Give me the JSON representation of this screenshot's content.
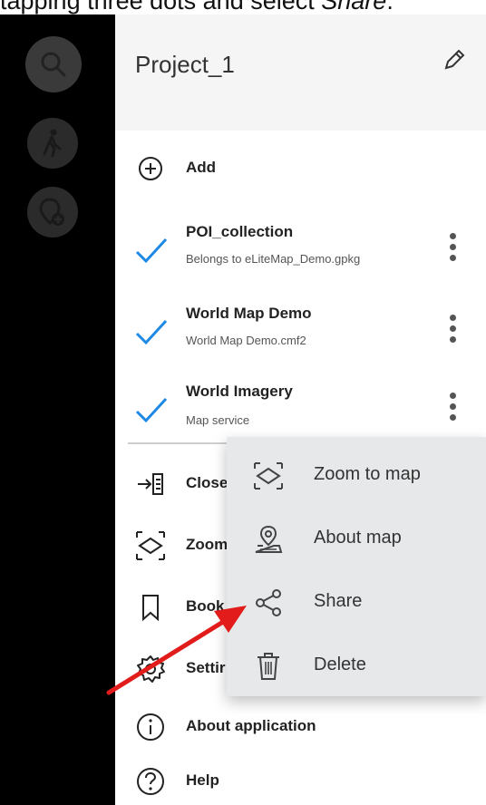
{
  "caption": {
    "prefix": "tapping three dots and select ",
    "emphasis": "Share",
    "suffix": "."
  },
  "map_controls": {
    "search_icon": "search-icon",
    "walk_icon": "walk-icon",
    "poi_icon": "add-poi-icon"
  },
  "drawer": {
    "title": "Project_1",
    "edit_icon": "pencil-icon",
    "add_label": "Add",
    "layers": [
      {
        "title": "POI_collection",
        "subtitle": "Belongs to eLiteMap_Demo.gpkg",
        "checked": true
      },
      {
        "title": "World Map Demo",
        "subtitle": "World Map Demo.cmf2",
        "checked": true
      },
      {
        "title": "World Imagery",
        "subtitle": "Map service",
        "checked": true
      }
    ],
    "menu": [
      {
        "label": "Close",
        "icon": "close-project-icon"
      },
      {
        "label": "Zoom",
        "icon": "zoom-extent-icon"
      },
      {
        "label": "Book",
        "icon": "bookmark-icon"
      },
      {
        "label": "Settir",
        "icon": "settings-icon"
      },
      {
        "label": "About application",
        "icon": "info-icon"
      },
      {
        "label": "Help",
        "icon": "help-icon"
      }
    ]
  },
  "popup": {
    "items": [
      {
        "label": "Zoom to map",
        "icon": "zoom-to-map-icon"
      },
      {
        "label": "About map",
        "icon": "about-map-icon"
      },
      {
        "label": "Share",
        "icon": "share-icon"
      },
      {
        "label": "Delete",
        "icon": "delete-icon"
      }
    ]
  },
  "colors": {
    "check": "#1e88e5",
    "arrow": "#e21b1b",
    "popup_bg": "#e6e8ea",
    "map_bg": "#000000"
  }
}
